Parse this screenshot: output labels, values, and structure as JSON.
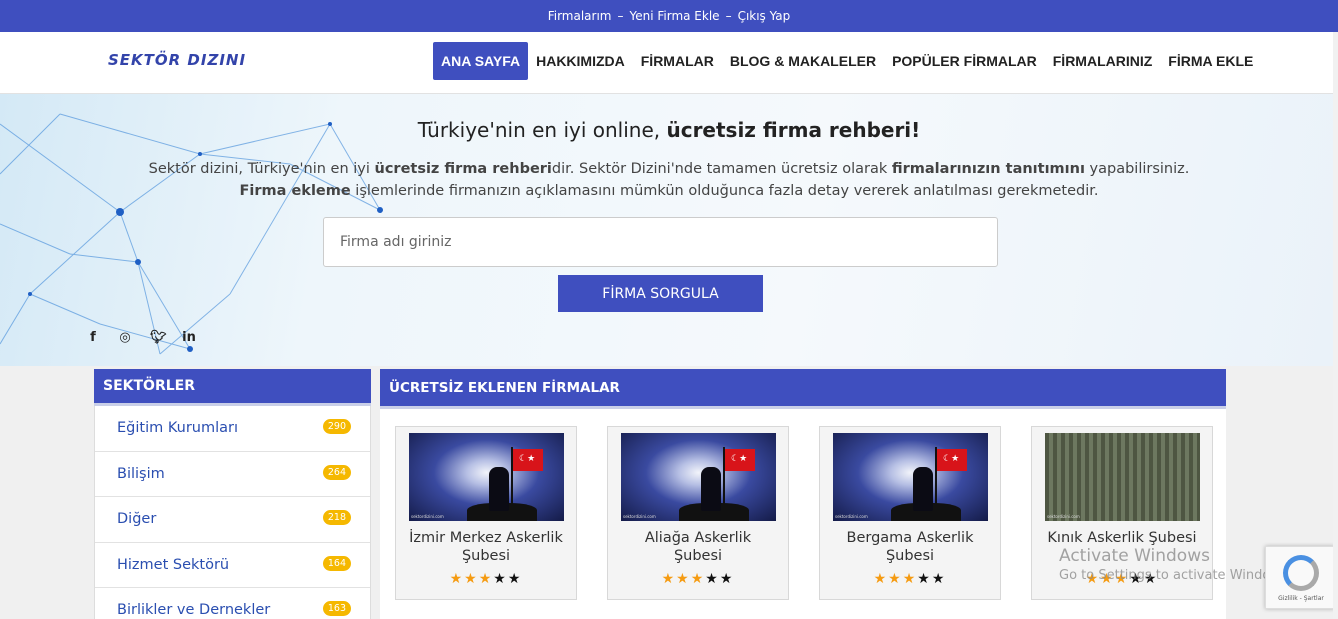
{
  "topbar": {
    "links": [
      "Firmalarım",
      "Yeni Firma Ekle",
      "Çıkış Yap"
    ],
    "separator": "–"
  },
  "header": {
    "logo": "SEKTÖR DIZINI",
    "nav": [
      "ANA SAYFA",
      "HAKKIMIZDA",
      "FİRMALAR",
      "BLOG & MAKALELER",
      "POPÜLER FİRMALAR",
      "FİRMALARINIZ",
      "FİRMA EKLE"
    ]
  },
  "hero": {
    "title_regular": "Türkiye'nin en iyi online, ",
    "title_bold": "ücretsiz firma rehberi!",
    "desc1_a": "Sektör dizini, Türkiye'nin en iyi ",
    "desc1_b": "ücretsiz firma rehberi",
    "desc1_c": "dir. Sektör Dizini'nde tamamen ücretsiz olarak ",
    "desc1_d": "firmalarınızın tanıtımını",
    "desc1_e": " yapabilirsiniz.",
    "desc2_a": "Firma ekleme",
    "desc2_b": " işlemlerinde firmanızın açıklamasını mümkün olduğunca fazla detay vererek anlatılması gerekmetedir.",
    "search_placeholder": "Firma adı giriniz",
    "search_button": "FİRMA SORGULA",
    "social": [
      "facebook-icon",
      "instagram-icon",
      "twitter-icon",
      "linkedin-icon"
    ]
  },
  "sidebar": {
    "title": "SEKTÖRLER",
    "items": [
      {
        "label": "Eğitim Kurumları",
        "count": "290"
      },
      {
        "label": "Bilişim",
        "count": "264"
      },
      {
        "label": "Diğer",
        "count": "218"
      },
      {
        "label": "Hizmet Sektörü",
        "count": "164"
      },
      {
        "label": "Birlikler ve Dernekler",
        "count": "163"
      }
    ]
  },
  "main": {
    "title": "ÜCRETSİZ EKLENEN FİRMALAR",
    "cards": [
      {
        "title": "İzmir Merkez Askerlik Şubesi",
        "rating": 3,
        "image": "soldier-flag"
      },
      {
        "title": "Aliağa Askerlik Şubesi",
        "rating": 3,
        "image": "soldier-flag"
      },
      {
        "title": "Bergama Askerlik Şubesi",
        "rating": 3,
        "image": "soldier-flag"
      },
      {
        "title": "Kınık Askerlik Şubesi",
        "rating": 3,
        "image": "parade"
      }
    ],
    "image_watermark": "sektordizini.com"
  },
  "overlay": {
    "activate_title": "Activate Windows",
    "activate_sub": "Go to Settings to activate Windows.",
    "recaptcha_text": "Gizlilik - Şartlar"
  },
  "colors": {
    "brand": "#3f4fbf",
    "badge": "#f5b800",
    "star": "#f59b12",
    "link": "#2a4eb0"
  }
}
